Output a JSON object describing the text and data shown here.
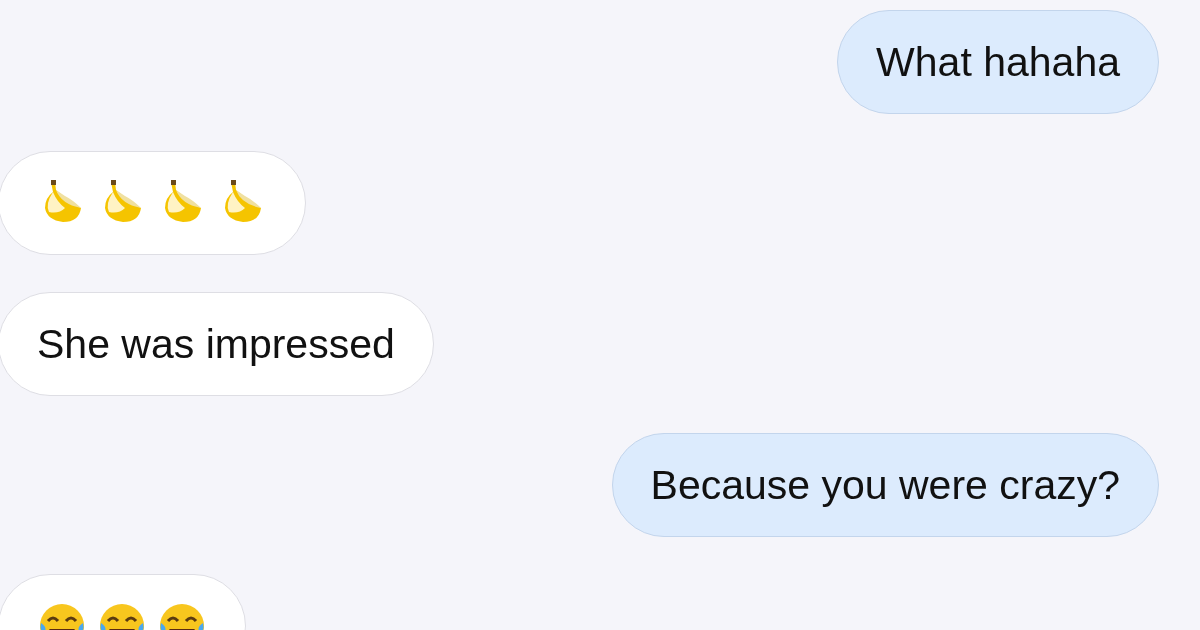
{
  "messages": [
    {
      "outgoing": true,
      "text": "What hahaha"
    },
    {
      "outgoing": false,
      "emojis": [
        {
          "kind": "banana"
        },
        {
          "kind": "banana"
        },
        {
          "kind": "banana"
        },
        {
          "kind": "banana"
        }
      ]
    },
    {
      "outgoing": false,
      "text": "She was impressed"
    },
    {
      "outgoing": true,
      "text": "Because you were crazy?"
    },
    {
      "outgoing": false,
      "emojis": [
        {
          "kind": "laughing"
        },
        {
          "kind": "laughing"
        },
        {
          "kind": "laughing"
        }
      ]
    }
  ]
}
